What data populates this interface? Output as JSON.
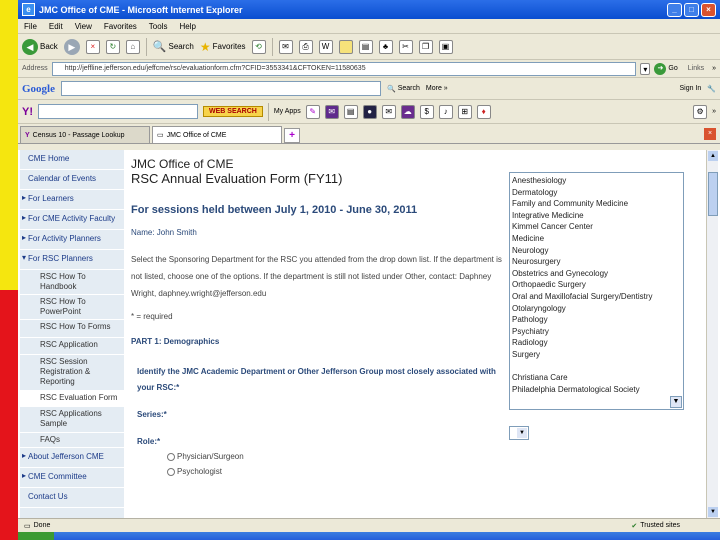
{
  "window": {
    "title": "JMC Office of CME - Microsoft Internet Explorer",
    "minimize": "_",
    "maximize": "□",
    "close": "×"
  },
  "menu": [
    "File",
    "Edit",
    "View",
    "Favorites",
    "Tools",
    "Help"
  ],
  "toolbar": {
    "back": "Back",
    "search": "Search",
    "favorites": "Favorites"
  },
  "address": {
    "label": "Address",
    "url": "http://jeffline.jefferson.edu/jeffcme/rsc/evaluationform.cfm?CFID=3553341&CFTOKEN=11580635",
    "go": "Go",
    "links": "Links"
  },
  "googlebar": {
    "logo": "Google",
    "search_menu": "Search",
    "more": "More »",
    "signin": "Sign In"
  },
  "yahoobar": {
    "logo": "Y!",
    "websearch": "WEB SEARCH",
    "myapps": "My Apps"
  },
  "tabs": [
    {
      "label": "Census 10 - Passage Lookup",
      "active": false
    },
    {
      "label": "JMC Office of CME",
      "active": true
    }
  ],
  "sidebar": {
    "items": [
      {
        "label": "CME Home",
        "type": "plain"
      },
      {
        "label": "Calendar of Events",
        "type": "plain"
      },
      {
        "label": "For Learners",
        "type": "arrow"
      },
      {
        "label": "For CME Activity Faculty",
        "type": "arrow"
      },
      {
        "label": "For Activity Planners",
        "type": "arrow"
      },
      {
        "label": "For RSC Planners",
        "type": "open"
      }
    ],
    "subitems": [
      {
        "label": "RSC How To Handbook"
      },
      {
        "label": "RSC How To PowerPoint"
      },
      {
        "label": "RSC How To Forms"
      },
      {
        "label": "RSC Application"
      },
      {
        "label": "RSC Session Registration & Reporting"
      },
      {
        "label": "RSC Evaluation Form",
        "active": true
      },
      {
        "label": "RSC Applications Sample"
      },
      {
        "label": "FAQs"
      }
    ],
    "bottom": [
      {
        "label": "About Jefferson CME",
        "type": "arrow"
      },
      {
        "label": "CME Committee",
        "type": "arrow"
      },
      {
        "label": "Contact Us",
        "type": "plain"
      }
    ]
  },
  "form": {
    "org": "JMC Office of CME",
    "title": "RSC Annual Evaluation Form (FY11)",
    "period": "For sessions held between July 1, 2010 - June 30, 2011",
    "name": "Name: John Smith",
    "instructions": "Select the Sponsoring Department for the RSC you attended from the drop down list. If the department is not listed, choose one of the options. If the department is still not listed under Other, contact: Daphney Wright, daphney.wright@jefferson.edu",
    "required": "* = required",
    "part": "PART 1: Demographics",
    "question": "Identify the JMC Academic Department or Other Jefferson Group most closely associated with your RSC:*",
    "series": "Series:*",
    "role": "Role:*",
    "roles": [
      "Physician/Surgeon",
      "Psychologist"
    ]
  },
  "departments": [
    "Anesthesiology",
    "Dermatology",
    "Family and Community Medicine",
    "Integrative Medicine",
    "Kimmel Cancer Center",
    "Medicine",
    "Neurology",
    "Neurosurgery",
    "Obstetrics and Gynecology",
    "Orthopaedic Surgery",
    "Oral and Maxillofacial Surgery/Dentistry",
    "Otolaryngology",
    "Pathology",
    "Psychiatry",
    "Radiology",
    "Surgery",
    "",
    "Christiana Care",
    "Philadelphia Dermatological Society"
  ],
  "status": {
    "left": "Done",
    "zone": "Trusted sites"
  }
}
